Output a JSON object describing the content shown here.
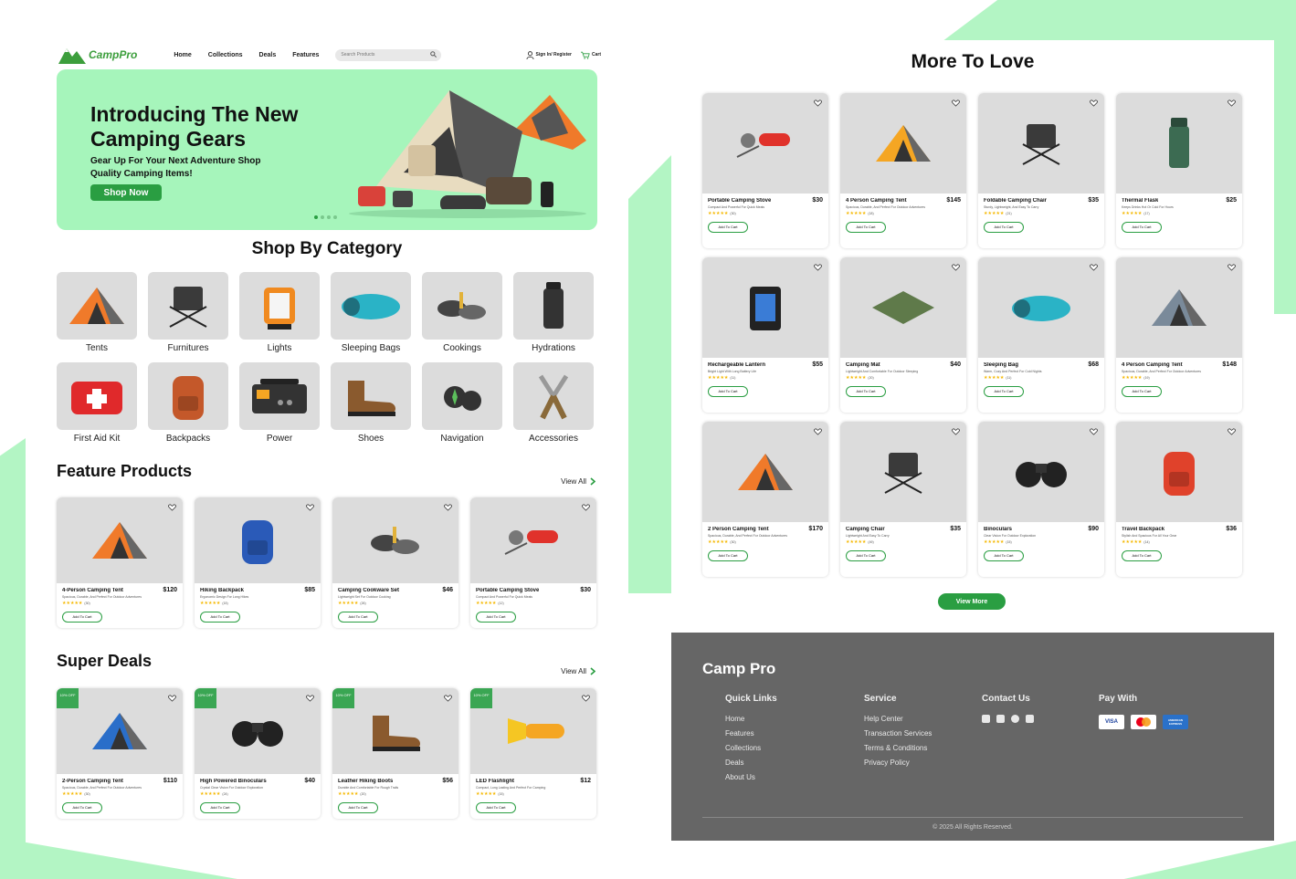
{
  "brand": {
    "logo_text": "CampPro"
  },
  "nav": {
    "links": [
      "Home",
      "Collections",
      "Deals",
      "Features"
    ],
    "search_placeholder": "Search Products",
    "sign_in": "Sign In/ Register",
    "cart": "Cart"
  },
  "hero": {
    "title": "Introducing The New Camping Gears",
    "subtitle": "Gear Up For Your Next Adventure Shop Quality Camping Items!",
    "button": "Shop Now"
  },
  "categories": {
    "title": "Shop By Category",
    "items": [
      "Tents",
      "Furnitures",
      "Lights",
      "Sleeping Bags",
      "Cookings",
      "Hydrations",
      "First Aid Kit",
      "Backpacks",
      "Power",
      "Shoes",
      "Navigation",
      "Accessories"
    ]
  },
  "featured": {
    "title": "Feature Products",
    "view_all": "View All",
    "products": [
      {
        "name": "4-Person Camping Tent",
        "price": "$120",
        "desc": "Spacious, Durable, And Perfect For Outdoor Adventures",
        "count": "(30)",
        "button": "Add To Cart"
      },
      {
        "name": "Hiking Backpack",
        "price": "$85",
        "desc": "Ergonomic Design For Long Hikes",
        "count": "(15)",
        "button": "Add To Cart"
      },
      {
        "name": "Camping Cookware Set",
        "price": "$46",
        "desc": "Lightweight Set For Outdoor Cooking",
        "count": "(26)",
        "button": "Add To Cart"
      },
      {
        "name": "Portable Camping Stove",
        "price": "$30",
        "desc": "Compact And Powerful For Quick Meals",
        "count": "(12)",
        "button": "Add To Cart"
      }
    ]
  },
  "deals": {
    "title": "Super Deals",
    "view_all": "View All",
    "badge": "10% OFF",
    "products": [
      {
        "name": "2-Person Camping Tent",
        "price": "$110",
        "desc": "Spacious, Durable, And Perfect For Outdoor Adventures",
        "count": "(30)",
        "button": "Add To Cart"
      },
      {
        "name": "High Powered Binoculars",
        "price": "$40",
        "desc": "Crystal Clear Vision For Outdoor Exploration",
        "count": "(24)",
        "button": "Add To Cart"
      },
      {
        "name": "Leather Hiking Boots",
        "price": "$56",
        "desc": "Durable And Comfortable For Rough Trails",
        "count": "(20)",
        "button": "Add To Cart"
      },
      {
        "name": "LED Flashlight",
        "price": "$12",
        "desc": "Compact, Long Lasting And Perfect For Camping",
        "count": "(15)",
        "button": "Add To Cart"
      }
    ]
  },
  "more": {
    "title": "More To Love",
    "view_more": "View More",
    "products": [
      {
        "name": "Portable Camping Stove",
        "price": "$30",
        "desc": "Compact And Powerful For Quick Meals",
        "count": "(30)",
        "button": "Add To Cart"
      },
      {
        "name": "4 Person Camping Tent",
        "price": "$145",
        "desc": "Spacious, Durable, And Perfect For Outdoor Adventures",
        "count": "(18)",
        "button": "Add To Cart"
      },
      {
        "name": "Foldable Camping Chair",
        "price": "$35",
        "desc": "Sturdy, Lightweight, And Easy To Carry",
        "count": "(21)",
        "button": "Add To Cart"
      },
      {
        "name": "Thermal Flask",
        "price": "$25",
        "desc": "Keeps Drinks Hot Or Cold For Hours",
        "count": "(17)",
        "button": "Add To Cart"
      },
      {
        "name": "Rechargeable Lantern",
        "price": "$55",
        "desc": "Bright Light With Long Battery Life",
        "count": "(11)",
        "button": "Add To Cart"
      },
      {
        "name": "Camping Mat",
        "price": "$40",
        "desc": "Lightweight And Comfortable For Outdoor Sleeping",
        "count": "(20)",
        "button": "Add To Cart"
      },
      {
        "name": "Sleeping Bag",
        "price": "$68",
        "desc": "Warm, Cozy And Perfect For Cold Nights",
        "count": "(11)",
        "button": "Add To Cart"
      },
      {
        "name": "4 Person Camping Tent",
        "price": "$148",
        "desc": "Spacious, Durable, And Perfect For Outdoor Adventures",
        "count": "(19)",
        "button": "Add To Cart"
      },
      {
        "name": "2 Person Camping Tent",
        "price": "$170",
        "desc": "Spacious, Durable, And Perfect For Outdoor Adventures",
        "count": "(30)",
        "button": "Add To Cart"
      },
      {
        "name": "Camping Chair",
        "price": "$35",
        "desc": "Lightweight And Easy To Carry",
        "count": "(49)",
        "button": "Add To Cart"
      },
      {
        "name": "Binoculars",
        "price": "$90",
        "desc": "Clear Vision For Outdoor Exploration",
        "count": "(15)",
        "button": "Add To Cart"
      },
      {
        "name": "Travel Backpack",
        "price": "$36",
        "desc": "Stylish And Spacious For All Your Gear",
        "count": "(14)",
        "button": "Add To Cart"
      }
    ]
  },
  "footer": {
    "brand": "Camp Pro",
    "quick_links": {
      "title": "Quick Links",
      "items": [
        "Home",
        "Features",
        "Collections",
        "Deals",
        "About Us"
      ]
    },
    "service": {
      "title": "Service",
      "items": [
        "Help Center",
        "Transaction Services",
        "Terms & Conditions",
        "Privacy Policy"
      ]
    },
    "contact": {
      "title": "Contact Us"
    },
    "pay": {
      "title": "Pay With",
      "methods": [
        "VISA",
        "mastercard",
        "AMERICAN EXPRESS"
      ]
    },
    "copyright": "© 2025 All Rights Reserved."
  },
  "colors": {
    "accent": "#2a9e42",
    "hero_bg": "#a6f5bb",
    "deco": "#b3f5c4",
    "footer_bg": "#666666",
    "star": "#f5b800"
  }
}
